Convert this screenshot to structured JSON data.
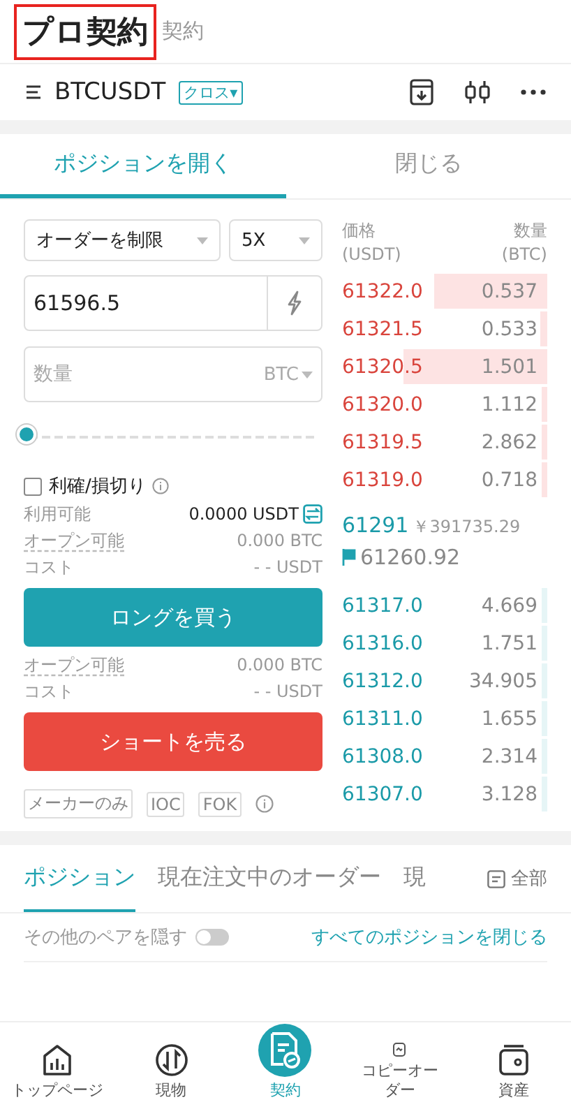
{
  "header": {
    "tabs": [
      {
        "label": "プロ契約",
        "selected": true
      },
      {
        "label": "契約",
        "selected": false
      }
    ]
  },
  "symbol_bar": {
    "symbol": "BTCUSDT",
    "margin_mode": "クロス▾"
  },
  "trade_tabs": [
    {
      "label": "ポジションを開く",
      "selected": true
    },
    {
      "label": "閉じる",
      "selected": false
    }
  ],
  "order_form": {
    "order_type": "オーダーを制限",
    "leverage": "5X",
    "price": "61596.5",
    "quantity": {
      "placeholder": "数量",
      "unit": "BTC"
    },
    "slider": {
      "level": 0
    },
    "tp_sl": {
      "label": "利確/損切り",
      "checked": false
    },
    "available": {
      "label": "利用可能",
      "value": "0.0000 USDT"
    },
    "long_info": [
      {
        "label": "オープン可能",
        "value": "0.000 BTC",
        "dashed": true
      },
      {
        "label": "コスト",
        "value": "- - USDT",
        "dashed": false
      }
    ],
    "buy_button": "ロングを買う",
    "short_info": [
      {
        "label": "オープン可能",
        "value": "0.000 BTC",
        "dashed": true
      },
      {
        "label": "コスト",
        "value": "- - USDT",
        "dashed": false
      }
    ],
    "sell_button": "ショートを売る",
    "options": [
      {
        "label": "メーカーのみ",
        "selected": false
      },
      {
        "label": "IOC",
        "selected": false
      },
      {
        "label": "FOK",
        "selected": false
      }
    ]
  },
  "order_book": {
    "price_header": "価格",
    "price_unit": "(USDT)",
    "qty_header": "数量",
    "qty_unit": "(BTC)",
    "asks": [
      {
        "price": "61322.0",
        "qty": "0.537"
      },
      {
        "price": "61321.5",
        "qty": "0.533"
      },
      {
        "price": "61320.5",
        "qty": "1.501"
      },
      {
        "price": "61320.0",
        "qty": "1.112"
      },
      {
        "price": "61319.5",
        "qty": "2.862"
      },
      {
        "price": "61319.0",
        "qty": "0.718"
      }
    ],
    "last_price": "61291",
    "last_price_cny": "￥391735.29",
    "mark_price": "61260.92",
    "bids": [
      {
        "price": "61317.0",
        "qty": "4.669"
      },
      {
        "price": "61316.0",
        "qty": "1.751"
      },
      {
        "price": "61312.0",
        "qty": "34.905"
      },
      {
        "price": "61311.0",
        "qty": "1.655"
      },
      {
        "price": "61308.0",
        "qty": "2.314"
      },
      {
        "price": "61307.0",
        "qty": "3.128"
      }
    ]
  },
  "position_tabs": [
    {
      "label": "ポジション",
      "selected": true
    },
    {
      "label": "現在注文中のオーダー",
      "selected": false
    },
    {
      "label": "現",
      "selected": false
    }
  ],
  "all_filter": "全部",
  "hide_pairs": {
    "label": "その他のペアを隠す",
    "on": false
  },
  "close_all": "すべてのポジションを閉じる",
  "bottom_nav": [
    {
      "label": "トップページ",
      "kind": "home",
      "selected": false
    },
    {
      "label": "現物",
      "kind": "spot",
      "selected": false
    },
    {
      "label": "契約",
      "kind": "contract",
      "selected": true
    },
    {
      "label": "コピーオーダー",
      "kind": "copy",
      "selected": false
    },
    {
      "label": "資産",
      "kind": "wallet",
      "selected": false
    }
  ]
}
